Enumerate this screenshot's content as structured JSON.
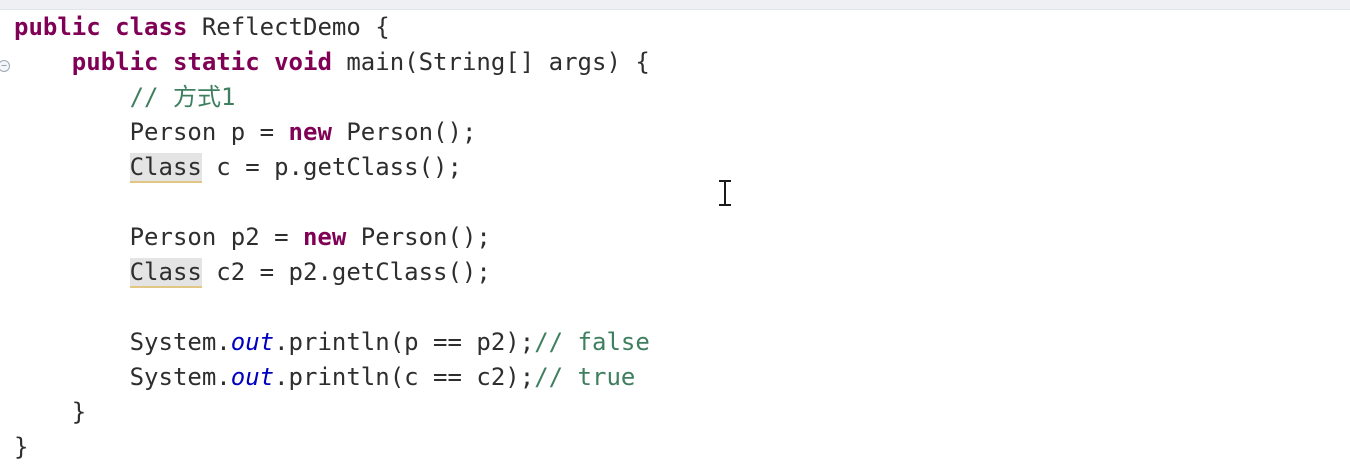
{
  "editor": {
    "fold_glyph": "−",
    "lines": [
      [
        {
          "t": "public",
          "c": "kw"
        },
        {
          "t": " "
        },
        {
          "t": "class",
          "c": "kw"
        },
        {
          "t": " ReflectDemo {"
        }
      ],
      [
        {
          "t": "    "
        },
        {
          "t": "public",
          "c": "kw"
        },
        {
          "t": " "
        },
        {
          "t": "static",
          "c": "kw"
        },
        {
          "t": " "
        },
        {
          "t": "void",
          "c": "kw"
        },
        {
          "t": " main(String[] args) {"
        }
      ],
      [
        {
          "t": "        "
        },
        {
          "t": "// 方式1",
          "c": "cm"
        }
      ],
      [
        {
          "t": "        Person p = "
        },
        {
          "t": "new",
          "c": "kw"
        },
        {
          "t": " Person();"
        }
      ],
      [
        {
          "t": "        "
        },
        {
          "t": "Class",
          "c": "occ"
        },
        {
          "t": " c = p.getClass();"
        }
      ],
      [
        {
          "t": ""
        }
      ],
      [
        {
          "t": "        Person p2 = "
        },
        {
          "t": "new",
          "c": "kw"
        },
        {
          "t": " Person();"
        }
      ],
      [
        {
          "t": "        "
        },
        {
          "t": "Class",
          "c": "occ"
        },
        {
          "t": " c2 = p2.getClass();"
        }
      ],
      [
        {
          "t": ""
        }
      ],
      [
        {
          "t": "        System."
        },
        {
          "t": "out",
          "c": "fld"
        },
        {
          "t": ".println(p == p2);"
        },
        {
          "t": "// false",
          "c": "cm"
        }
      ],
      [
        {
          "t": "        System."
        },
        {
          "t": "out",
          "c": "fld"
        },
        {
          "t": ".println(c == c2);"
        },
        {
          "t": "// true",
          "c": "cm"
        }
      ],
      [
        {
          "t": "    }"
        }
      ],
      [
        {
          "t": "}"
        }
      ]
    ]
  }
}
